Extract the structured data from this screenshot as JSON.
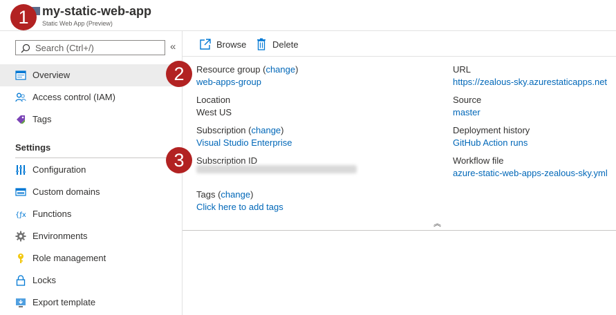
{
  "header": {
    "title": "my-static-web-app",
    "subtitle": "Static Web App (Preview)"
  },
  "callouts": [
    "1",
    "2",
    "3"
  ],
  "sidebar": {
    "search_placeholder": "Search (Ctrl+/)",
    "collapse_glyph": "«",
    "items": [
      {
        "label": "Overview",
        "icon": "overview-icon"
      },
      {
        "label": "Access control (IAM)",
        "icon": "iam-icon"
      },
      {
        "label": "Tags",
        "icon": "tag-icon"
      }
    ],
    "section_title": "Settings",
    "settings_items": [
      {
        "label": "Configuration",
        "icon": "configuration-icon"
      },
      {
        "label": "Custom domains",
        "icon": "custom-domains-icon"
      },
      {
        "label": "Functions",
        "icon": "functions-icon"
      },
      {
        "label": "Environments",
        "icon": "gear-icon"
      },
      {
        "label": "Role management",
        "icon": "key-icon"
      },
      {
        "label": "Locks",
        "icon": "lock-icon"
      },
      {
        "label": "Export template",
        "icon": "export-template-icon"
      }
    ]
  },
  "toolbar": {
    "browse_label": "Browse",
    "delete_label": "Delete"
  },
  "essentials": {
    "resource_group_label": "Resource group",
    "resource_group_change": "change",
    "resource_group_value": "web-apps-group",
    "location_label": "Location",
    "location_value": "West US",
    "subscription_label": "Subscription",
    "subscription_change": "change",
    "subscription_value": "Visual Studio Enterprise",
    "subscription_id_label": "Subscription ID",
    "tags_label": "Tags",
    "tags_change": "change",
    "tags_value": "Click here to add tags",
    "url_label": "URL",
    "url_value": "https://zealous-sky.azurestaticapps.net",
    "source_label": "Source",
    "source_value": "master",
    "deployment_history_label": "Deployment history",
    "deployment_history_value": "GitHub Action runs",
    "workflow_file_label": "Workflow file",
    "workflow_file_value": "azure-static-web-apps-zealous-sky.yml",
    "collapse_glyph": "︽"
  },
  "colors": {
    "link": "#0067b8",
    "callout": "#b22222",
    "active_nav": "#ececec"
  }
}
